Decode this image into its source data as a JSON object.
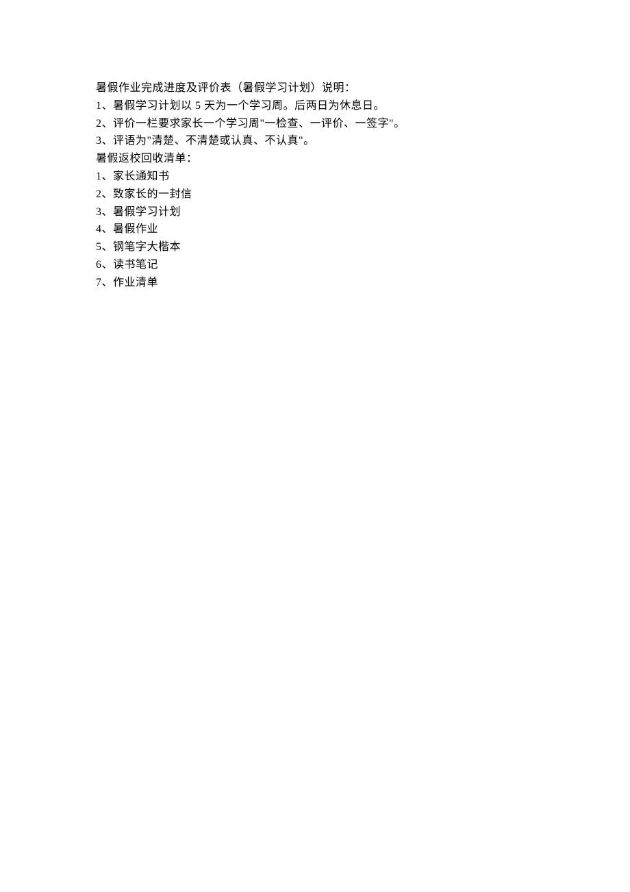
{
  "title": "暑假作业完成进度及评价表（暑假学习计划）说明：",
  "instructions": [
    "1、暑假学习计划以 5 天为一个学习周。后两日为休息日。",
    "2、评价一栏要求家长一个学习周\"一检查、一评价、一签字\"。",
    "3、评语为\"清楚、不清楚或认真、不认真\"。"
  ],
  "checklist_title": "暑假返校回收清单：",
  "checklist_items": [
    "1、家长通知书",
    "2、致家长的一封信",
    "3、暑假学习计划",
    "4、暑假作业",
    "5、钢笔字大楷本",
    "6、读书笔记",
    "7、作业清单"
  ]
}
